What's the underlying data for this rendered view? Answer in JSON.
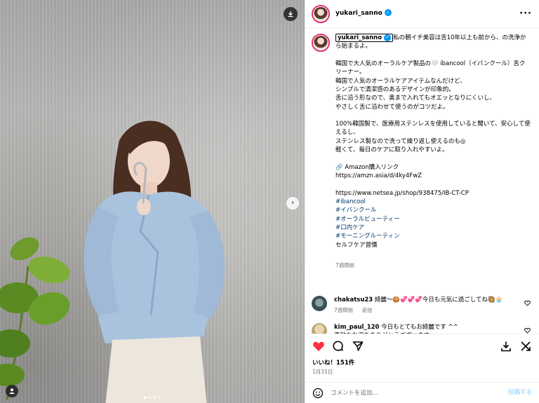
{
  "post": {
    "username": "yukari_sanno",
    "caption_main": "私の朝イチ美容は舌10年以上も前から、の洗浄から始まるよ。\n\n韓国で大人気のオーラルケア製品の🤍 ibancool（イバンクール）舌クリーナー。\n韓国で人気のオーラルケアアイテムなんだけど、\nシンプルで清潔感のあるデザインが印象的。\n舌に沿う形なので、奥まで入れてもオエッとなりにくいし、\nやさしく舌に沿わせて使うのがコツだよ。\n\n100%韓国製で、医療用ステンレスを使用していると聞いて、安心して使えるし、\nステンレス製なので洗って繰り返し使えるのも◎\n軽くて、毎日のケアに取り入れやすいよ。\n\n🔗 Amazon購入リンク\nhttps://amzn.asia/d/4ky4FwZ\n\nhttps://www.netsea.jp/shop/938475/IB-CT-CP\n",
    "hashtags": [
      "#ibancool",
      "#イバンクール",
      "#オーラルビューティー",
      "#口内ケア",
      "#モーニングルーティン"
    ],
    "caption_tail": "セルフケア習慣",
    "caption_time": "7週間前",
    "likes": "いいね！151件",
    "date": "1月31日"
  },
  "comments": [
    {
      "user": "chakatsu23",
      "text": "綺麗〜🍪💞💞💞今日も元気に過ごしてね🥘🧁",
      "time": "7週間前",
      "reply": "返信",
      "avatar_color": "#5a6f7a"
    },
    {
      "user": "kim_paul_120",
      "text": "今日もとてもお綺麗です ^^\n素敵なお姿をありがとうございます。\n暖かい週末の始まりですね。お会いできて嬉しいです ^^",
      "time": "",
      "reply": "",
      "avatar_color": "#c9b48a"
    }
  ],
  "add_comment": {
    "placeholder": "コメントを追加...",
    "post_label": "投稿する"
  },
  "colors": {
    "like_red": "#ff3040",
    "link_blue": "#00376b",
    "verified_blue": "#0095f6"
  }
}
